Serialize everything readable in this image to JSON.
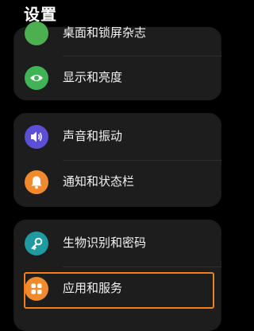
{
  "header": {
    "title": "设置"
  },
  "groups": [
    {
      "items": [
        {
          "label": "桌面和锁屏杂志",
          "icon": "home-screen-icon",
          "color": "#4caf50"
        },
        {
          "label": "显示和亮度",
          "icon": "eye-icon",
          "color": "#3fb356"
        }
      ]
    },
    {
      "items": [
        {
          "label": "声音和振动",
          "icon": "speaker-icon",
          "color": "#5b4fd6"
        },
        {
          "label": "通知和状态栏",
          "icon": "bell-icon",
          "color": "#f08a2a"
        }
      ]
    },
    {
      "items": [
        {
          "label": "生物识别和密码",
          "icon": "key-icon",
          "color": "#1e9aa0"
        },
        {
          "label": "应用和服务",
          "icon": "apps-grid-icon",
          "color": "#f08a2a"
        }
      ]
    }
  ],
  "highlight_color": "#f07f1f"
}
